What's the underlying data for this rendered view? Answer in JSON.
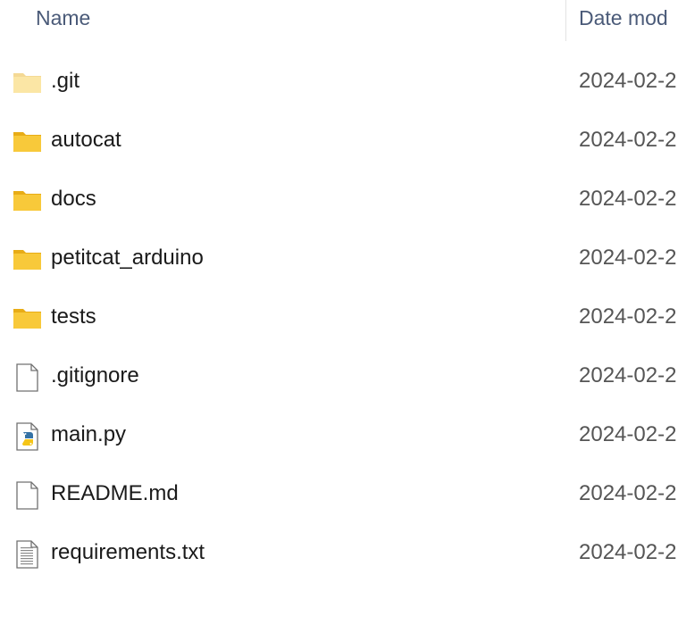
{
  "columns": {
    "name": "Name",
    "date": "Date mod"
  },
  "files": [
    {
      "name": ".git",
      "icon": "folder-icon",
      "date": "2024-02-2",
      "hidden": true
    },
    {
      "name": "autocat",
      "icon": "folder-icon",
      "date": "2024-02-2"
    },
    {
      "name": "docs",
      "icon": "folder-icon",
      "date": "2024-02-2"
    },
    {
      "name": "petitcat_arduino",
      "icon": "folder-icon",
      "date": "2024-02-2"
    },
    {
      "name": "tests",
      "icon": "folder-icon",
      "date": "2024-02-2"
    },
    {
      "name": ".gitignore",
      "icon": "file-icon",
      "date": "2024-02-2"
    },
    {
      "name": "main.py",
      "icon": "python-file-icon",
      "date": "2024-02-2"
    },
    {
      "name": "README.md",
      "icon": "file-icon",
      "date": "2024-02-2"
    },
    {
      "name": "requirements.txt",
      "icon": "text-file-icon",
      "date": "2024-02-2"
    }
  ],
  "colors": {
    "folder": "#f8c93a",
    "folder_dark": "#e8ac16",
    "header_text": "#4a5a78"
  }
}
